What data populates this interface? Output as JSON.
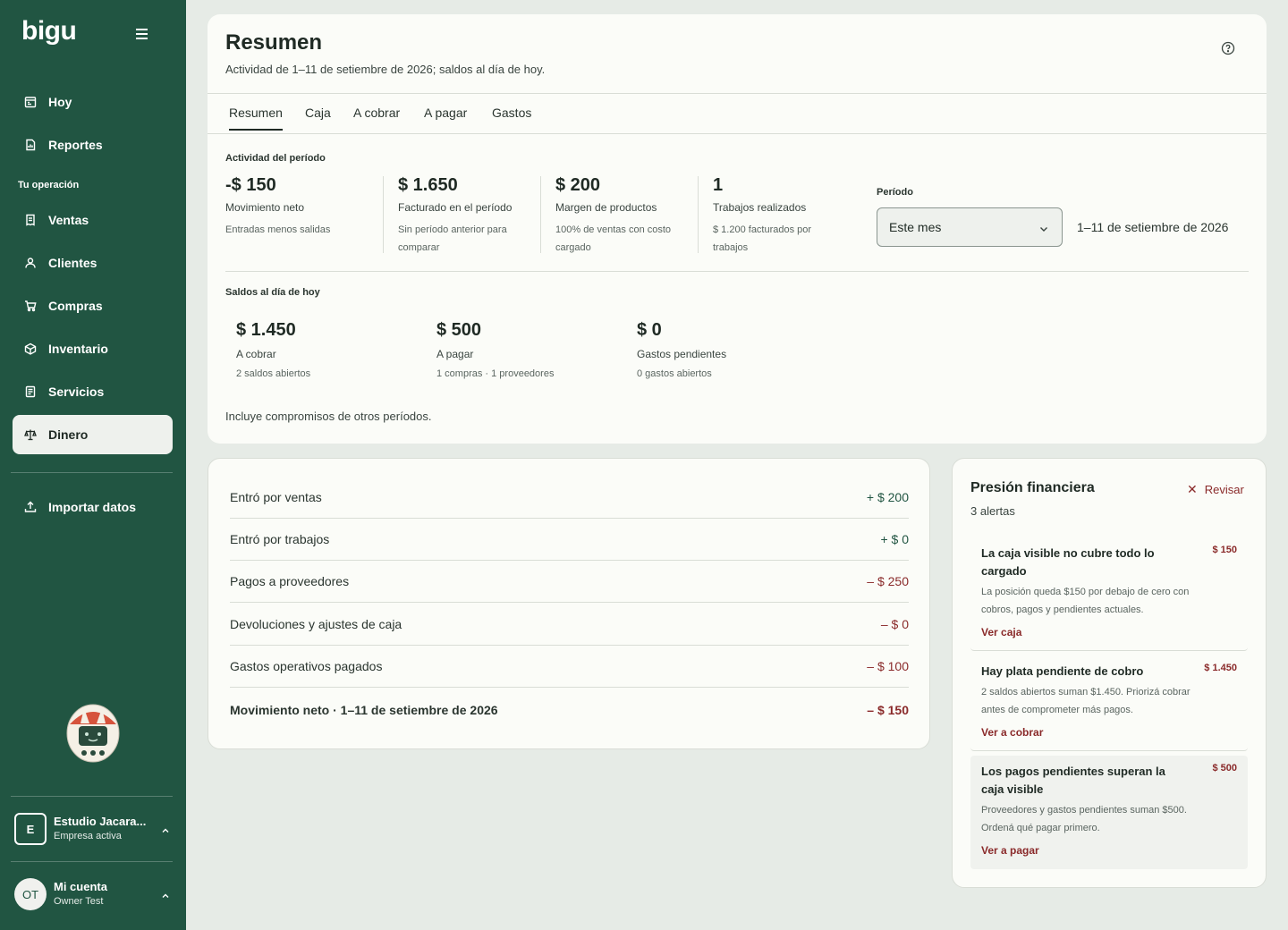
{
  "sidebar": {
    "logo": "bigu",
    "items": [
      {
        "label": "Hoy",
        "icon": "calendar-icon"
      },
      {
        "label": "Reportes",
        "icon": "report-icon"
      }
    ],
    "section_label": "Tu operación",
    "operation_items": [
      {
        "label": "Ventas",
        "icon": "receipt-icon"
      },
      {
        "label": "Clientes",
        "icon": "user-icon"
      },
      {
        "label": "Compras",
        "icon": "cart-icon"
      },
      {
        "label": "Inventario",
        "icon": "box-icon"
      },
      {
        "label": "Servicios",
        "icon": "document-icon"
      },
      {
        "label": "Dinero",
        "icon": "scale-icon",
        "active": true
      }
    ],
    "import_label": "Importar datos",
    "company": {
      "initial": "E",
      "name": "Estudio Jacara...",
      "status": "Empresa activa"
    },
    "account": {
      "initials": "OT",
      "name": "Mi cuenta",
      "user": "Owner Test"
    }
  },
  "header": {
    "title": "Resumen",
    "subtitle": "Actividad de 1–11 de setiembre de 2026; saldos al día de hoy."
  },
  "tabs": [
    "Resumen",
    "Caja",
    "A cobrar",
    "A pagar",
    "Gastos"
  ],
  "activity": {
    "heading": "Actividad del período",
    "metrics": [
      {
        "value": "-$ 150",
        "label": "Movimiento neto",
        "sub": "Entradas menos salidas"
      },
      {
        "value": "$ 1.650",
        "label": "Facturado en el período",
        "sub": "Sin período anterior para comparar"
      },
      {
        "value": "$ 200",
        "label": "Margen de productos",
        "sub": "100% de ventas con costo cargado"
      },
      {
        "value": "1",
        "label": "Trabajos realizados",
        "sub": "$ 1.200 facturados por trabajos"
      }
    ],
    "period_label": "Período",
    "period_value": "Este mes",
    "period_range": "1–11 de setiembre de 2026"
  },
  "balances": {
    "heading": "Saldos al día de hoy",
    "items": [
      {
        "value": "$ 1.450",
        "label": "A cobrar",
        "sub": "2 saldos abiertos"
      },
      {
        "value": "$ 500",
        "label": "A pagar",
        "sub": "1 compras · 1 proveedores"
      },
      {
        "value": "$ 0",
        "label": "Gastos pendientes",
        "sub": "0 gastos abiertos"
      }
    ],
    "note": "Incluye compromisos de otros períodos."
  },
  "cash_flow": [
    {
      "label": "Entró por ventas",
      "amount": "+ $ 200",
      "kind": "pos"
    },
    {
      "label": "Entró por trabajos",
      "amount": "+ $ 0",
      "kind": "pos"
    },
    {
      "label": "Pagos a proveedores",
      "amount": "– $ 250",
      "kind": "neg"
    },
    {
      "label": "Devoluciones y ajustes de caja",
      "amount": "– $ 0",
      "kind": "neg"
    },
    {
      "label": "Gastos operativos pagados",
      "amount": "– $ 100",
      "kind": "neg"
    },
    {
      "label": "Movimiento neto · 1–11 de setiembre de 2026",
      "amount": "– $ 150",
      "kind": "neg"
    }
  ],
  "pressure": {
    "title": "Presión financiera",
    "count": "3 alertas",
    "review_label": "Revisar",
    "alerts": [
      {
        "title": "La caja visible no cubre todo lo cargado",
        "amount": "$ 150",
        "desc": "La posición queda $150 por debajo de cero con cobros, pagos y pendientes actuales.",
        "link": "Ver caja"
      },
      {
        "title": "Hay plata pendiente de cobro",
        "amount": "$ 1.450",
        "desc": "2 saldos abiertos suman $1.450. Priorizá cobrar antes de comprometer más pagos.",
        "link": "Ver a cobrar"
      },
      {
        "title": "Los pagos pendientes superan la caja visible",
        "amount": "$ 500",
        "desc": "Proveedores y gastos pendientes suman $500. Ordená qué pagar primero.",
        "link": "Ver a pagar"
      }
    ]
  }
}
